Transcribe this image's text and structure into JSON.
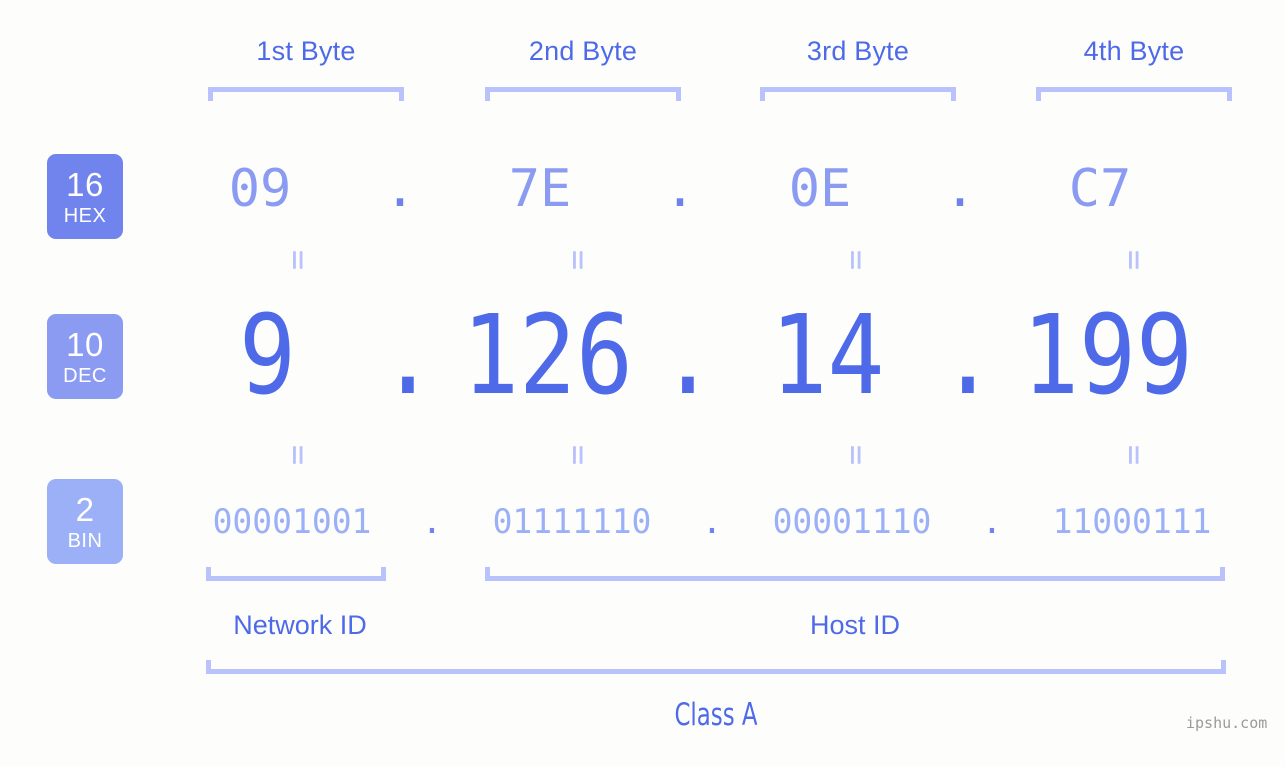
{
  "meta": {
    "watermark": "ipshu.com",
    "background_color": "#fdfefb",
    "accent_color": "#4f6ae8",
    "bracket_color": "#b9c2fb"
  },
  "byte_headers": [
    {
      "label": "1st Byte"
    },
    {
      "label": "2nd Byte"
    },
    {
      "label": "3rd Byte"
    },
    {
      "label": "4th Byte"
    }
  ],
  "bases": [
    {
      "number": "16",
      "abbr": "HEX",
      "color": "#7183ec"
    },
    {
      "number": "10",
      "abbr": "DEC",
      "color": "#8b9bf2"
    },
    {
      "number": "2",
      "abbr": "BIN",
      "color": "#9bb0f7"
    }
  ],
  "separator": ".",
  "equals_mark": "=",
  "rows": {
    "hex": {
      "octets": [
        "09",
        "7E",
        "0E",
        "C7"
      ]
    },
    "dec": {
      "octets": [
        "9",
        "126",
        "14",
        "199"
      ]
    },
    "bin": {
      "octets": [
        "00001001",
        "01111110",
        "00001110",
        "11000111"
      ]
    }
  },
  "sections": [
    {
      "label": "Network ID"
    },
    {
      "label": "Host ID"
    }
  ],
  "class": {
    "label": "Class A"
  }
}
